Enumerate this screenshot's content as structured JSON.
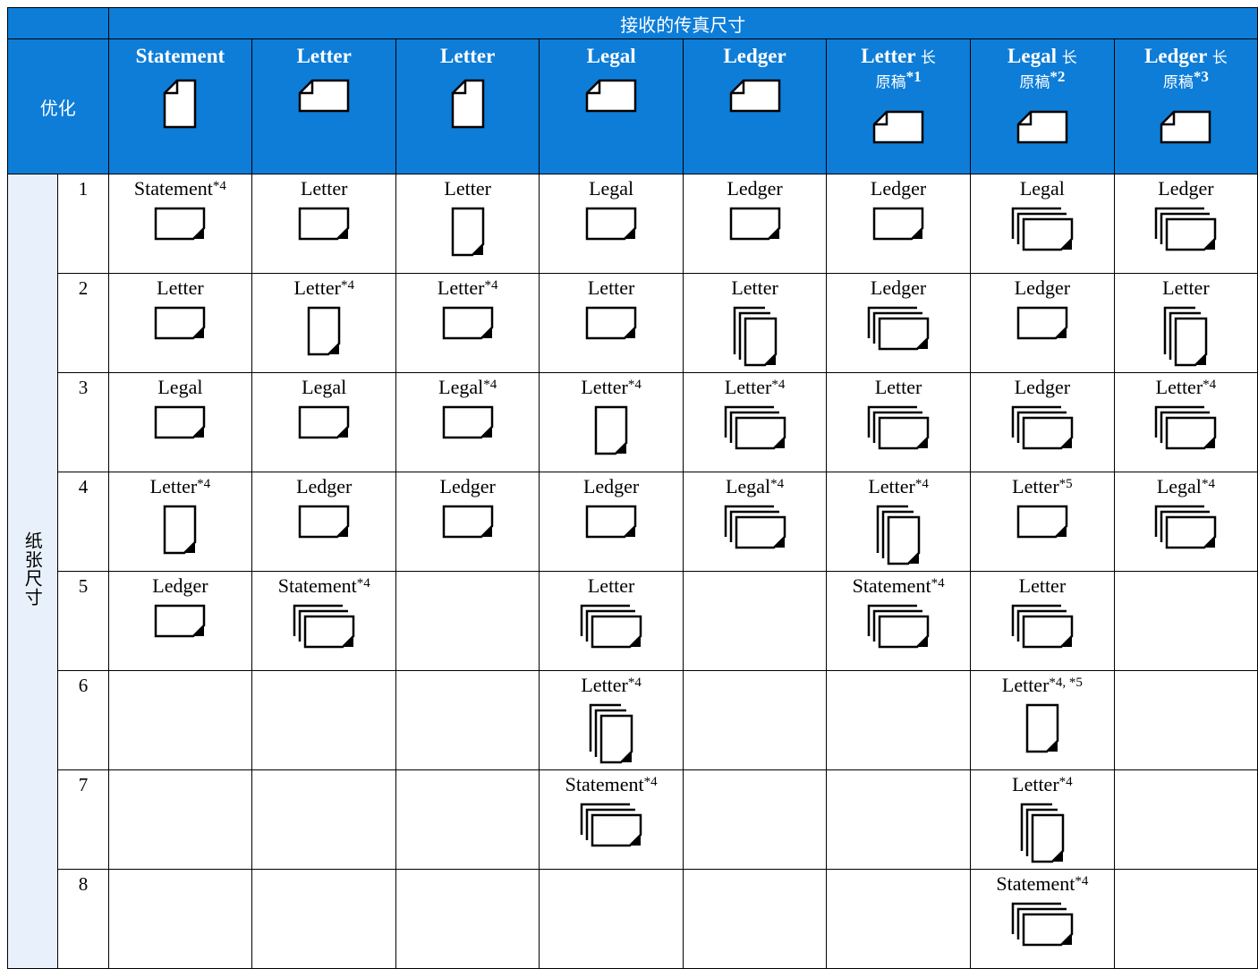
{
  "header": {
    "title": "接收的传真尺寸",
    "optimize_label": "优化",
    "columns": [
      {
        "name": "Statement",
        "orientation": "portrait",
        "suffix": "",
        "note": ""
      },
      {
        "name": "Letter",
        "orientation": "landscape",
        "suffix": "",
        "note": ""
      },
      {
        "name": "Letter",
        "orientation": "portrait",
        "suffix": "",
        "note": ""
      },
      {
        "name": "Legal",
        "orientation": "landscape",
        "suffix": "",
        "note": ""
      },
      {
        "name": "Ledger",
        "orientation": "landscape",
        "suffix": "",
        "note": ""
      },
      {
        "name": "Letter",
        "orientation": "landscape",
        "suffix": "长",
        "sub": "原稿",
        "note": "*1"
      },
      {
        "name": "Legal",
        "orientation": "landscape",
        "suffix": "长",
        "sub": "原稿",
        "note": "*2"
      },
      {
        "name": "Ledger",
        "orientation": "landscape",
        "suffix": "长",
        "sub": "原稿",
        "note": "*3"
      }
    ]
  },
  "paper_size_label": "纸张尺寸",
  "rows": [
    {
      "num": "1",
      "cells": [
        {
          "text": "Statement",
          "note": "*4",
          "icon": "sheet-landscape"
        },
        {
          "text": "Letter",
          "note": "",
          "icon": "sheet-landscape"
        },
        {
          "text": "Letter",
          "note": "",
          "icon": "sheet-portrait"
        },
        {
          "text": "Legal",
          "note": "",
          "icon": "sheet-landscape"
        },
        {
          "text": "Ledger",
          "note": "",
          "icon": "sheet-landscape"
        },
        {
          "text": "Ledger",
          "note": "",
          "icon": "sheet-landscape"
        },
        {
          "text": "Legal",
          "note": "",
          "icon": "stack-landscape"
        },
        {
          "text": "Ledger",
          "note": "",
          "icon": "stack-landscape"
        }
      ]
    },
    {
      "num": "2",
      "cells": [
        {
          "text": "Letter",
          "note": "",
          "icon": "sheet-landscape"
        },
        {
          "text": "Letter",
          "note": "*4",
          "icon": "sheet-portrait"
        },
        {
          "text": "Letter",
          "note": "*4",
          "icon": "sheet-landscape"
        },
        {
          "text": "Letter",
          "note": "",
          "icon": "sheet-landscape"
        },
        {
          "text": "Letter",
          "note": "",
          "icon": "stack-portrait"
        },
        {
          "text": "Ledger",
          "note": "",
          "icon": "stack-landscape"
        },
        {
          "text": "Ledger",
          "note": "",
          "icon": "sheet-landscape"
        },
        {
          "text": "Letter",
          "note": "",
          "icon": "stack-portrait"
        }
      ]
    },
    {
      "num": "3",
      "cells": [
        {
          "text": "Legal",
          "note": "",
          "icon": "sheet-landscape"
        },
        {
          "text": "Legal",
          "note": "",
          "icon": "sheet-landscape"
        },
        {
          "text": "Legal",
          "note": "*4",
          "icon": "sheet-landscape"
        },
        {
          "text": "Letter",
          "note": "*4",
          "icon": "sheet-portrait"
        },
        {
          "text": "Letter",
          "note": "*4",
          "icon": "stack-landscape"
        },
        {
          "text": "Letter",
          "note": "",
          "icon": "stack-landscape"
        },
        {
          "text": "Ledger",
          "note": "",
          "icon": "stack-landscape"
        },
        {
          "text": "Letter",
          "note": "*4",
          "icon": "stack-landscape"
        }
      ]
    },
    {
      "num": "4",
      "cells": [
        {
          "text": "Letter",
          "note": "*4",
          "icon": "sheet-portrait"
        },
        {
          "text": "Ledger",
          "note": "",
          "icon": "sheet-landscape"
        },
        {
          "text": "Ledger",
          "note": "",
          "icon": "sheet-landscape"
        },
        {
          "text": "Ledger",
          "note": "",
          "icon": "sheet-landscape"
        },
        {
          "text": "Legal",
          "note": "*4",
          "icon": "stack-landscape"
        },
        {
          "text": "Letter",
          "note": "*4",
          "icon": "stack-portrait"
        },
        {
          "text": "Letter",
          "note": "*5",
          "icon": "sheet-landscape"
        },
        {
          "text": "Legal",
          "note": "*4",
          "icon": "stack-landscape"
        }
      ]
    },
    {
      "num": "5",
      "cells": [
        {
          "text": "Ledger",
          "note": "",
          "icon": "sheet-landscape"
        },
        {
          "text": "Statement",
          "note": "*4",
          "icon": "stack-landscape"
        },
        {
          "text": "",
          "note": "",
          "icon": ""
        },
        {
          "text": "Letter",
          "note": "",
          "icon": "stack-landscape"
        },
        {
          "text": "",
          "note": "",
          "icon": ""
        },
        {
          "text": "Statement",
          "note": "*4",
          "icon": "stack-landscape"
        },
        {
          "text": "Letter",
          "note": "",
          "icon": "stack-landscape"
        },
        {
          "text": "",
          "note": "",
          "icon": ""
        }
      ]
    },
    {
      "num": "6",
      "cells": [
        {
          "text": "",
          "note": "",
          "icon": ""
        },
        {
          "text": "",
          "note": "",
          "icon": ""
        },
        {
          "text": "",
          "note": "",
          "icon": ""
        },
        {
          "text": "Letter",
          "note": "*4",
          "icon": "stack-portrait"
        },
        {
          "text": "",
          "note": "",
          "icon": ""
        },
        {
          "text": "",
          "note": "",
          "icon": ""
        },
        {
          "text": "Letter",
          "note": "*4, *5",
          "icon": "sheet-portrait"
        },
        {
          "text": "",
          "note": "",
          "icon": ""
        }
      ]
    },
    {
      "num": "7",
      "cells": [
        {
          "text": "",
          "note": "",
          "icon": ""
        },
        {
          "text": "",
          "note": "",
          "icon": ""
        },
        {
          "text": "",
          "note": "",
          "icon": ""
        },
        {
          "text": "Statement",
          "note": "*4",
          "icon": "stack-landscape"
        },
        {
          "text": "",
          "note": "",
          "icon": ""
        },
        {
          "text": "",
          "note": "",
          "icon": ""
        },
        {
          "text": "Letter",
          "note": "*4",
          "icon": "stack-portrait"
        },
        {
          "text": "",
          "note": "",
          "icon": ""
        }
      ]
    },
    {
      "num": "8",
      "cells": [
        {
          "text": "",
          "note": "",
          "icon": ""
        },
        {
          "text": "",
          "note": "",
          "icon": ""
        },
        {
          "text": "",
          "note": "",
          "icon": ""
        },
        {
          "text": "",
          "note": "",
          "icon": ""
        },
        {
          "text": "",
          "note": "",
          "icon": ""
        },
        {
          "text": "",
          "note": "",
          "icon": ""
        },
        {
          "text": "Statement",
          "note": "*4",
          "icon": "stack-landscape"
        },
        {
          "text": "",
          "note": "",
          "icon": ""
        }
      ]
    }
  ],
  "colors": {
    "header_bg": "#0d7dd8",
    "side_bg": "#e8f1fb"
  }
}
